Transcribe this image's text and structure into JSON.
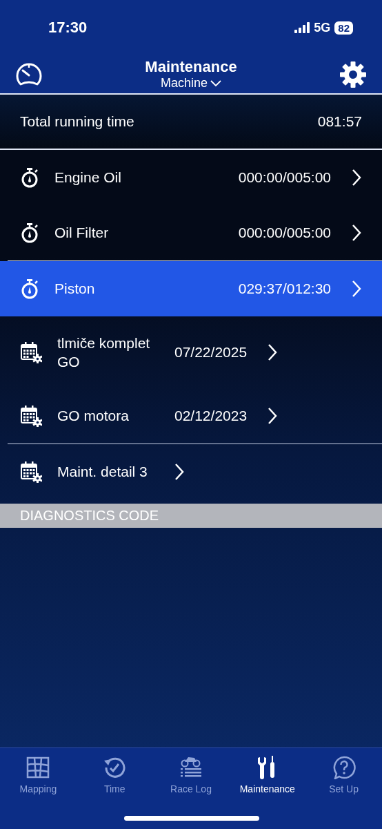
{
  "status_bar": {
    "time": "17:30",
    "network": "5G",
    "battery": "82"
  },
  "header": {
    "title": "Maintenance",
    "subtitle": "Machine"
  },
  "total": {
    "label": "Total running time",
    "value": "081:57"
  },
  "groups": [
    {
      "items": [
        {
          "kind": "timer",
          "name": "Engine Oil",
          "value": "000:00/005:00",
          "selected": false
        },
        {
          "kind": "timer",
          "name": "Oil Filter",
          "value": "000:00/005:00",
          "selected": false
        }
      ]
    },
    {
      "items": [
        {
          "kind": "timer",
          "name": "Piston",
          "value": "029:37/012:30",
          "selected": true
        },
        {
          "kind": "calendar",
          "name": "tlmiče komplet GO",
          "value": "07/22/2025",
          "selected": false
        },
        {
          "kind": "calendar",
          "name": "GO motora",
          "value": "02/12/2023",
          "selected": false
        }
      ]
    },
    {
      "items": [
        {
          "kind": "calendar",
          "name": "Maint. detail 3",
          "selected": false
        }
      ]
    }
  ],
  "section_header": "DIAGNOSTICS CODE",
  "tabs": [
    {
      "kind": "map",
      "label": "Mapping",
      "selected": false
    },
    {
      "kind": "time",
      "label": "Time",
      "selected": false
    },
    {
      "kind": "racelog",
      "label": "Race Log",
      "selected": false
    },
    {
      "kind": "tools",
      "label": "Maintenance",
      "selected": true
    },
    {
      "kind": "help",
      "label": "Set Up",
      "selected": false
    }
  ]
}
